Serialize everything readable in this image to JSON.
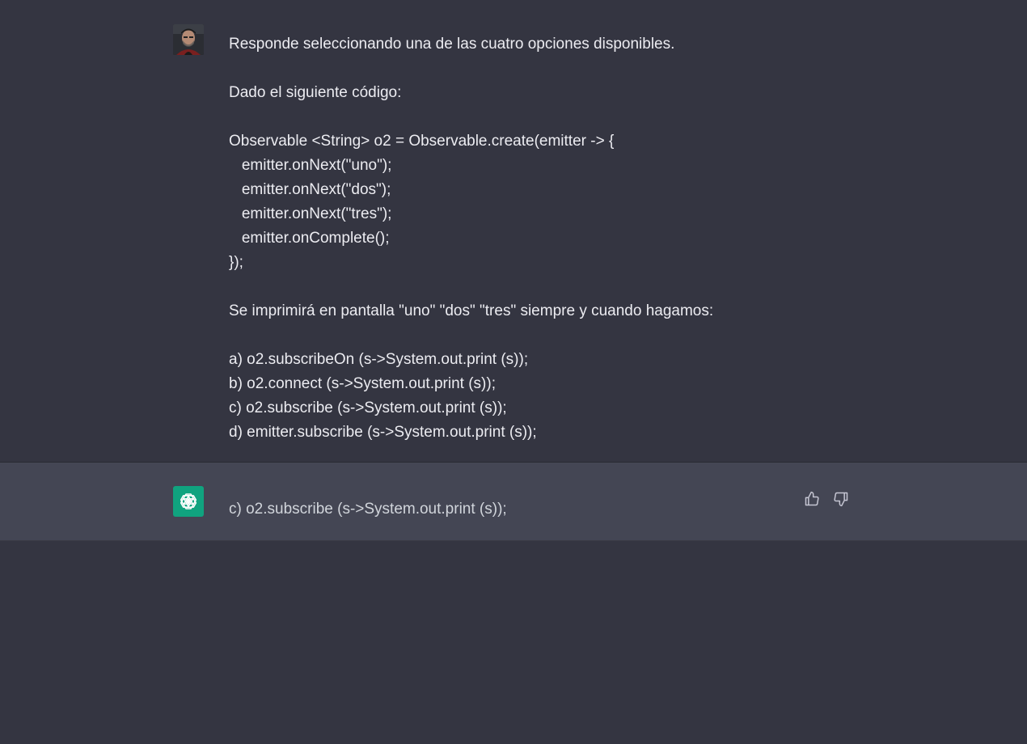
{
  "conversation": {
    "user": {
      "avatar_icon": "user-photo-avatar",
      "lines": [
        "Responde seleccionando una de las cuatro opciones disponibles.",
        "",
        "Dado el siguiente código:",
        "",
        "Observable <String> o2 = Observable.create(emitter -> {",
        "   emitter.onNext(\"uno\");",
        "   emitter.onNext(\"dos\");",
        "   emitter.onNext(\"tres\");",
        "   emitter.onComplete();",
        "});",
        "",
        "Se imprimirá en pantalla \"uno\" \"dos\" \"tres\" siempre y cuando hagamos:",
        "",
        "a) o2.subscribeOn (s->System.out.print (s));",
        "b) o2.connect (s->System.out.print (s));",
        "c) o2.subscribe (s->System.out.print (s));",
        "d) emitter.subscribe (s->System.out.print (s));"
      ]
    },
    "assistant": {
      "avatar_icon": "openai-logo-icon",
      "answer": "c) o2.subscribe (s->System.out.print (s));",
      "feedback": {
        "thumbs_up_icon": "thumbs-up-icon",
        "thumbs_down_icon": "thumbs-down-icon"
      }
    }
  },
  "colors": {
    "background": "#343541",
    "assistant_background": "#444654",
    "text": "#ececf1",
    "assistant_text": "#d1d5db",
    "brand_green": "#10a37f"
  }
}
